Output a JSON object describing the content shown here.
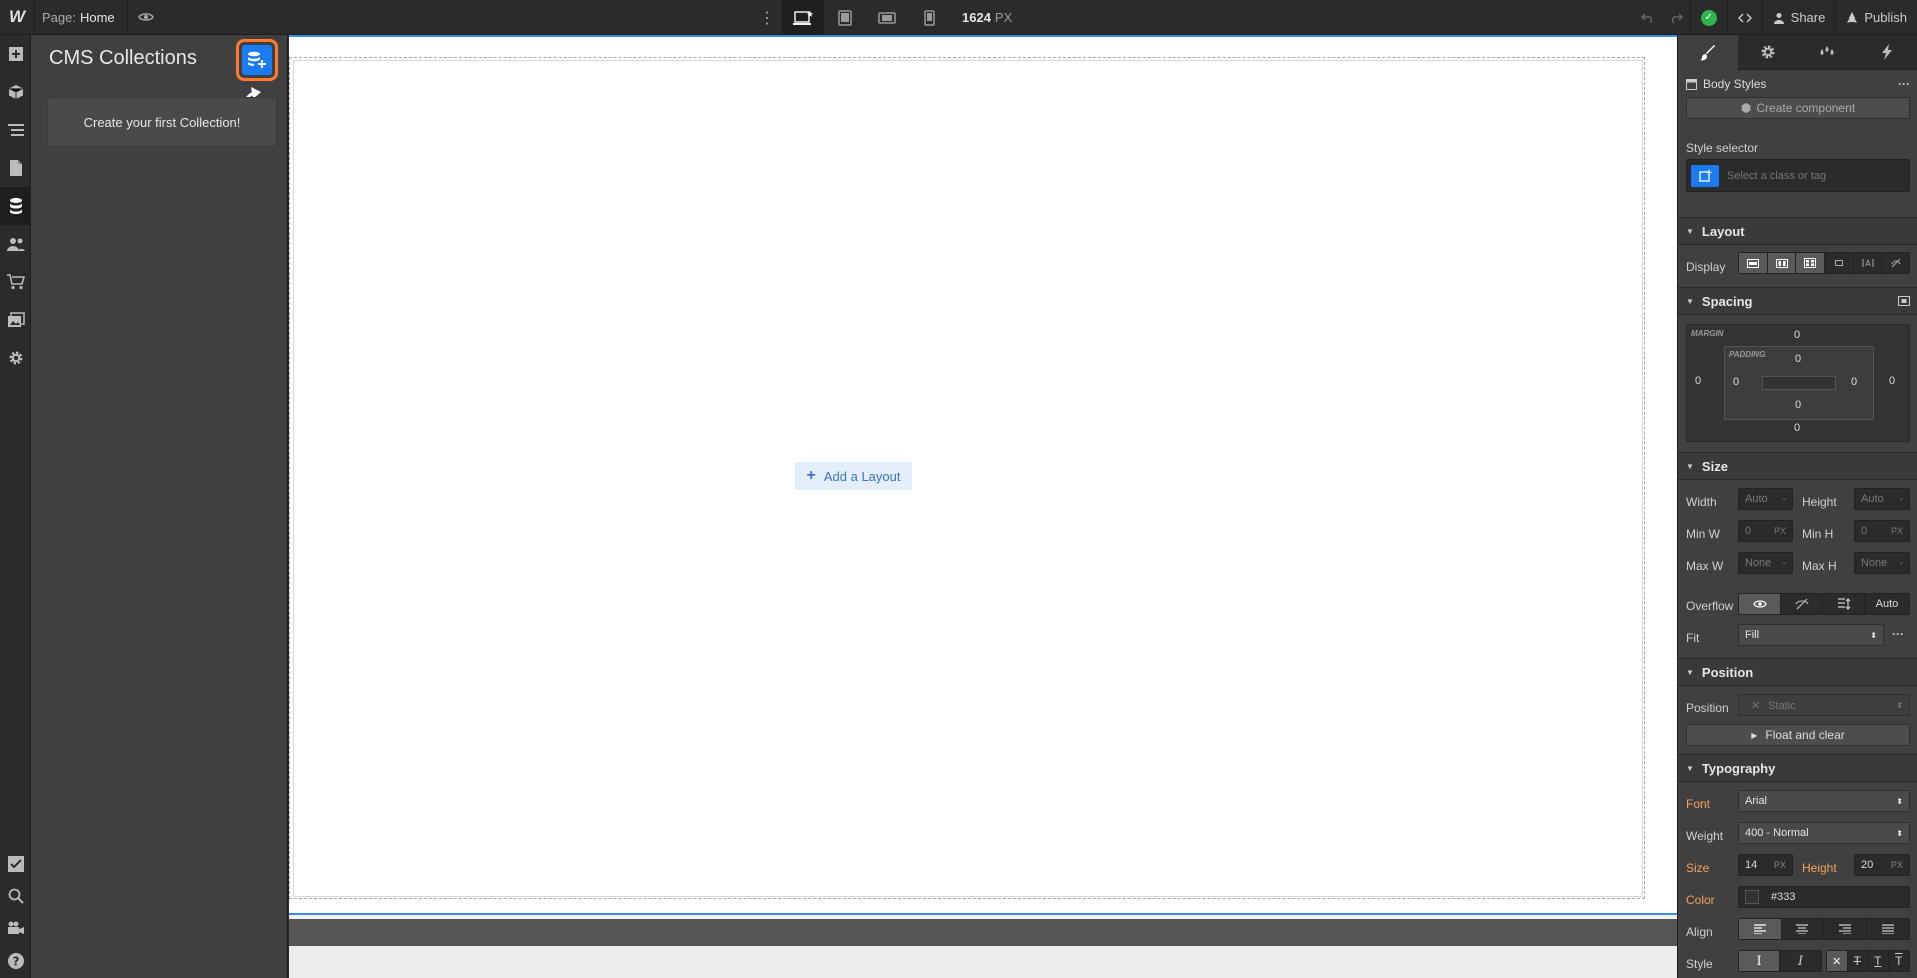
{
  "topbar": {
    "logo": "W",
    "page_label": "Page:",
    "page_name": "Home",
    "viewport_width": "1624",
    "viewport_unit": "PX",
    "share_label": "Share",
    "publish_label": "Publish"
  },
  "cms": {
    "title": "CMS Collections",
    "empty_message": "Create your first Collection!"
  },
  "canvas": {
    "add_layout_label": "Add a Layout"
  },
  "style_panel": {
    "selection_label": "Body Styles",
    "create_component_label": "Create component",
    "style_selector_label": "Style selector",
    "style_selector_placeholder": "Select a class or tag",
    "layout": {
      "heading": "Layout",
      "display_label": "Display"
    },
    "spacing": {
      "heading": "Spacing",
      "margin_label": "MARGIN",
      "padding_label": "PADDING",
      "margin_top": "0",
      "margin_right": "0",
      "margin_bottom": "0",
      "margin_left": "0",
      "padding_top": "0",
      "padding_right": "0",
      "padding_bottom": "0",
      "padding_left": "0"
    },
    "size": {
      "heading": "Size",
      "width_label": "Width",
      "width_value": "Auto",
      "width_unit": "-",
      "height_label": "Height",
      "height_value": "Auto",
      "height_unit": "-",
      "minw_label": "Min W",
      "minw_value": "0",
      "minw_unit": "PX",
      "minh_label": "Min H",
      "minh_value": "0",
      "minh_unit": "PX",
      "maxw_label": "Max W",
      "maxw_value": "None",
      "maxw_unit": "-",
      "maxh_label": "Max H",
      "maxh_value": "None",
      "maxh_unit": "-",
      "overflow_label": "Overflow",
      "overflow_auto": "Auto",
      "fit_label": "Fit",
      "fit_value": "Fill"
    },
    "position": {
      "heading": "Position",
      "position_label": "Position",
      "position_value": "Static",
      "float_clear_label": "Float and clear"
    },
    "typography": {
      "heading": "Typography",
      "font_label": "Font",
      "font_value": "Arial",
      "weight_label": "Weight",
      "weight_value": "400 - Normal",
      "size_label": "Size",
      "size_value": "14",
      "size_unit": "PX",
      "height_label": "Height",
      "height_value": "20",
      "height_unit": "PX",
      "color_label": "Color",
      "color_value": "#333",
      "align_label": "Align",
      "style_label": "Style"
    }
  },
  "colors": {
    "accent_blue": "#1a7cf3",
    "highlight_orange": "#ff7a2f",
    "status_green": "#2fb54b",
    "inherited_orange": "#f5a05c"
  }
}
